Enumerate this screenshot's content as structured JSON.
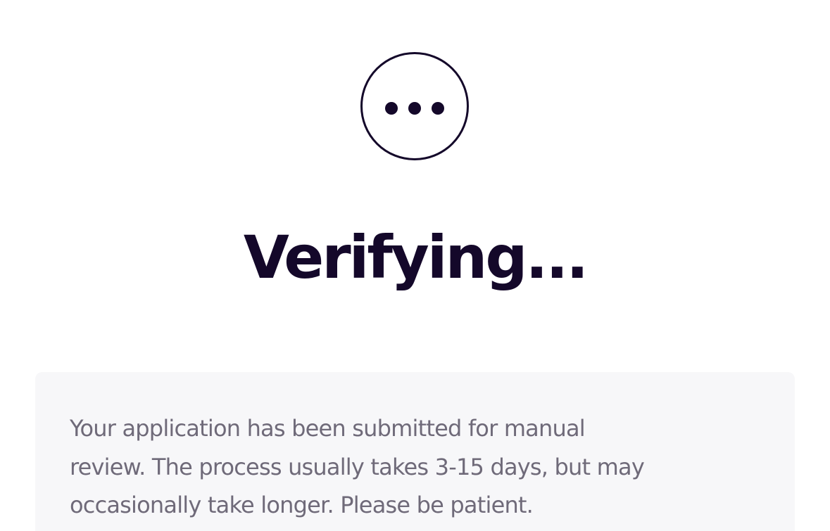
{
  "status": {
    "icon": "more-horizontal-circle-icon",
    "title": "Verifying...",
    "message_lines": [
      "Your application has been submitted for manual",
      "review. The process usually takes 3-15 days, but may",
      "occasionally take longer. Please be patient."
    ]
  },
  "colors": {
    "text_primary": "#14082a",
    "text_secondary": "#6f6a79",
    "panel_background": "#f7f7f9",
    "page_background": "#ffffff"
  }
}
